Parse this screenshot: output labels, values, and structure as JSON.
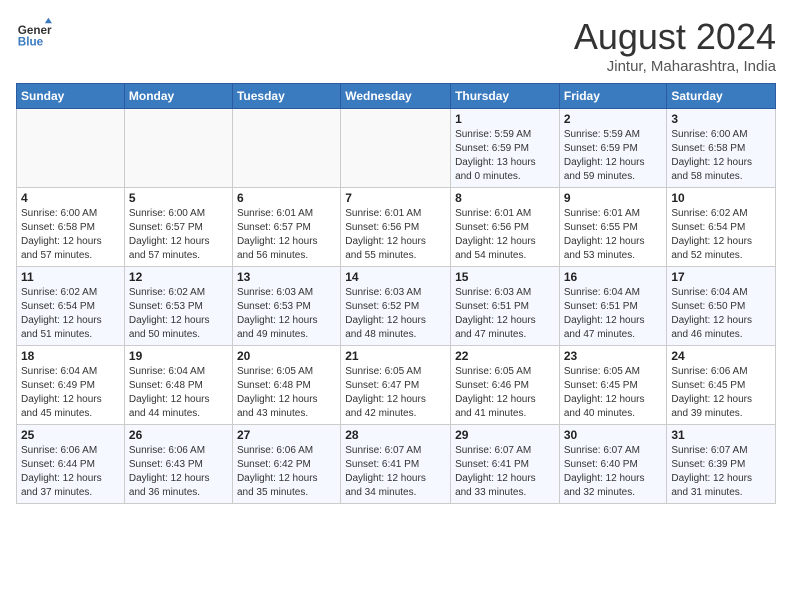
{
  "header": {
    "logo_line1": "General",
    "logo_line2": "Blue",
    "month_year": "August 2024",
    "location": "Jintur, Maharashtra, India"
  },
  "weekdays": [
    "Sunday",
    "Monday",
    "Tuesday",
    "Wednesday",
    "Thursday",
    "Friday",
    "Saturday"
  ],
  "weeks": [
    [
      {
        "day": "",
        "info": ""
      },
      {
        "day": "",
        "info": ""
      },
      {
        "day": "",
        "info": ""
      },
      {
        "day": "",
        "info": ""
      },
      {
        "day": "1",
        "info": "Sunrise: 5:59 AM\nSunset: 6:59 PM\nDaylight: 13 hours\nand 0 minutes."
      },
      {
        "day": "2",
        "info": "Sunrise: 5:59 AM\nSunset: 6:59 PM\nDaylight: 12 hours\nand 59 minutes."
      },
      {
        "day": "3",
        "info": "Sunrise: 6:00 AM\nSunset: 6:58 PM\nDaylight: 12 hours\nand 58 minutes."
      }
    ],
    [
      {
        "day": "4",
        "info": "Sunrise: 6:00 AM\nSunset: 6:58 PM\nDaylight: 12 hours\nand 57 minutes."
      },
      {
        "day": "5",
        "info": "Sunrise: 6:00 AM\nSunset: 6:57 PM\nDaylight: 12 hours\nand 57 minutes."
      },
      {
        "day": "6",
        "info": "Sunrise: 6:01 AM\nSunset: 6:57 PM\nDaylight: 12 hours\nand 56 minutes."
      },
      {
        "day": "7",
        "info": "Sunrise: 6:01 AM\nSunset: 6:56 PM\nDaylight: 12 hours\nand 55 minutes."
      },
      {
        "day": "8",
        "info": "Sunrise: 6:01 AM\nSunset: 6:56 PM\nDaylight: 12 hours\nand 54 minutes."
      },
      {
        "day": "9",
        "info": "Sunrise: 6:01 AM\nSunset: 6:55 PM\nDaylight: 12 hours\nand 53 minutes."
      },
      {
        "day": "10",
        "info": "Sunrise: 6:02 AM\nSunset: 6:54 PM\nDaylight: 12 hours\nand 52 minutes."
      }
    ],
    [
      {
        "day": "11",
        "info": "Sunrise: 6:02 AM\nSunset: 6:54 PM\nDaylight: 12 hours\nand 51 minutes."
      },
      {
        "day": "12",
        "info": "Sunrise: 6:02 AM\nSunset: 6:53 PM\nDaylight: 12 hours\nand 50 minutes."
      },
      {
        "day": "13",
        "info": "Sunrise: 6:03 AM\nSunset: 6:53 PM\nDaylight: 12 hours\nand 49 minutes."
      },
      {
        "day": "14",
        "info": "Sunrise: 6:03 AM\nSunset: 6:52 PM\nDaylight: 12 hours\nand 48 minutes."
      },
      {
        "day": "15",
        "info": "Sunrise: 6:03 AM\nSunset: 6:51 PM\nDaylight: 12 hours\nand 47 minutes."
      },
      {
        "day": "16",
        "info": "Sunrise: 6:04 AM\nSunset: 6:51 PM\nDaylight: 12 hours\nand 47 minutes."
      },
      {
        "day": "17",
        "info": "Sunrise: 6:04 AM\nSunset: 6:50 PM\nDaylight: 12 hours\nand 46 minutes."
      }
    ],
    [
      {
        "day": "18",
        "info": "Sunrise: 6:04 AM\nSunset: 6:49 PM\nDaylight: 12 hours\nand 45 minutes."
      },
      {
        "day": "19",
        "info": "Sunrise: 6:04 AM\nSunset: 6:48 PM\nDaylight: 12 hours\nand 44 minutes."
      },
      {
        "day": "20",
        "info": "Sunrise: 6:05 AM\nSunset: 6:48 PM\nDaylight: 12 hours\nand 43 minutes."
      },
      {
        "day": "21",
        "info": "Sunrise: 6:05 AM\nSunset: 6:47 PM\nDaylight: 12 hours\nand 42 minutes."
      },
      {
        "day": "22",
        "info": "Sunrise: 6:05 AM\nSunset: 6:46 PM\nDaylight: 12 hours\nand 41 minutes."
      },
      {
        "day": "23",
        "info": "Sunrise: 6:05 AM\nSunset: 6:45 PM\nDaylight: 12 hours\nand 40 minutes."
      },
      {
        "day": "24",
        "info": "Sunrise: 6:06 AM\nSunset: 6:45 PM\nDaylight: 12 hours\nand 39 minutes."
      }
    ],
    [
      {
        "day": "25",
        "info": "Sunrise: 6:06 AM\nSunset: 6:44 PM\nDaylight: 12 hours\nand 37 minutes."
      },
      {
        "day": "26",
        "info": "Sunrise: 6:06 AM\nSunset: 6:43 PM\nDaylight: 12 hours\nand 36 minutes."
      },
      {
        "day": "27",
        "info": "Sunrise: 6:06 AM\nSunset: 6:42 PM\nDaylight: 12 hours\nand 35 minutes."
      },
      {
        "day": "28",
        "info": "Sunrise: 6:07 AM\nSunset: 6:41 PM\nDaylight: 12 hours\nand 34 minutes."
      },
      {
        "day": "29",
        "info": "Sunrise: 6:07 AM\nSunset: 6:41 PM\nDaylight: 12 hours\nand 33 minutes."
      },
      {
        "day": "30",
        "info": "Sunrise: 6:07 AM\nSunset: 6:40 PM\nDaylight: 12 hours\nand 32 minutes."
      },
      {
        "day": "31",
        "info": "Sunrise: 6:07 AM\nSunset: 6:39 PM\nDaylight: 12 hours\nand 31 minutes."
      }
    ]
  ]
}
